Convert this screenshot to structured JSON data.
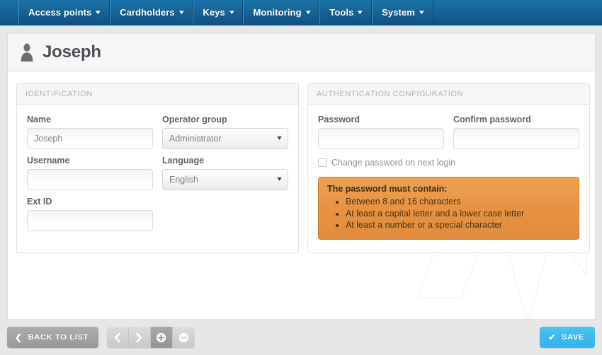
{
  "navbar": {
    "items": [
      {
        "label": "Access points",
        "caret": "chevron-down-icon"
      },
      {
        "label": "Cardholders",
        "caret": "chevron-down-icon"
      },
      {
        "label": "Keys",
        "caret": "chevron-down-icon"
      },
      {
        "label": "Monitoring",
        "caret": "chevron-down-icon"
      },
      {
        "label": "Tools",
        "caret": "chevron-down-icon"
      },
      {
        "label": "System",
        "caret": "chevron-down-icon"
      }
    ],
    "caret_glyph": "▾",
    "background_color": "#166193"
  },
  "header": {
    "title": "Joseph",
    "icon": "user-icon"
  },
  "identification": {
    "heading": "IDENTIFICATION",
    "name": {
      "label": "Name",
      "value": "Joseph",
      "placeholder": ""
    },
    "operator_group": {
      "label": "Operator group",
      "value": "Administrator",
      "options": [
        "Administrator"
      ]
    },
    "username": {
      "label": "Username",
      "value": "",
      "placeholder": ""
    },
    "language": {
      "label": "Language",
      "value": "English",
      "options": [
        "English"
      ]
    },
    "ext_id": {
      "label": "Ext ID",
      "value": "",
      "placeholder": ""
    }
  },
  "authentication": {
    "heading": "AUTHENTICATION CONFIGURATION",
    "password": {
      "label": "Password",
      "value": "",
      "placeholder": ""
    },
    "confirm_password": {
      "label": "Confirm password",
      "value": "",
      "placeholder": ""
    },
    "change_on_next_login": {
      "label": "Change password on next login",
      "checked": false
    },
    "alert": {
      "title": "The password must contain:",
      "color": "#e79343",
      "rules": [
        "Between 8 and 16 characters",
        "At least a capital letter and a lower case letter",
        "At least a number or a special character"
      ]
    }
  },
  "toolbar": {
    "back_label": "BACK TO LIST",
    "back_icon": "chevron-left-icon",
    "pager": [
      {
        "name": "prev",
        "icon": "chevron-left-icon",
        "active": false
      },
      {
        "name": "next",
        "icon": "chevron-right-icon",
        "active": false
      },
      {
        "name": "add",
        "icon": "plus-circle-icon",
        "active": true
      },
      {
        "name": "remove",
        "icon": "minus-circle-icon",
        "active": false
      }
    ],
    "save_label": "SAVE",
    "save_icon": "check-icon",
    "save_color": "#3cb9ef"
  }
}
